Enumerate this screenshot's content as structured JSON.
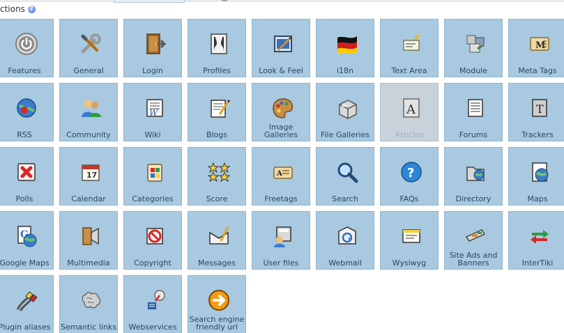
{
  "section": {
    "title": "ctions",
    "help_icon": "help-icon"
  },
  "tiles": [
    {
      "label": "Features",
      "icon": "power-icon"
    },
    {
      "label": "General",
      "icon": "wrench-screwdriver-icon"
    },
    {
      "label": "Login",
      "icon": "door-login-icon"
    },
    {
      "label": "Profiles",
      "icon": "profiles-icon"
    },
    {
      "label": "Look & Feel",
      "icon": "paint-window-icon"
    },
    {
      "label": "i18n",
      "icon": "flag-icon"
    },
    {
      "label": "Text Area",
      "icon": "text-area-icon"
    },
    {
      "label": "Module",
      "icon": "module-icon"
    },
    {
      "label": "Meta Tags",
      "icon": "meta-tags-icon"
    },
    {
      "label": "RSS",
      "icon": "rss-globe-icon"
    },
    {
      "label": "Community",
      "icon": "community-icon"
    },
    {
      "label": "Wiki",
      "icon": "wiki-icon"
    },
    {
      "label": "Blogs",
      "icon": "blogs-icon"
    },
    {
      "label": "Image Galleries",
      "icon": "palette-icon"
    },
    {
      "label": "File Galleries",
      "icon": "file-galleries-icon"
    },
    {
      "label": "Articles",
      "icon": "articles-icon",
      "disabled": true
    },
    {
      "label": "Forums",
      "icon": "forums-icon"
    },
    {
      "label": "Trackers",
      "icon": "trackers-icon"
    },
    {
      "label": "Polls",
      "icon": "polls-icon"
    },
    {
      "label": "Calendar",
      "icon": "calendar-icon"
    },
    {
      "label": "Categories",
      "icon": "categories-icon"
    },
    {
      "label": "Score",
      "icon": "score-stars-icon"
    },
    {
      "label": "Freetags",
      "icon": "freetags-icon"
    },
    {
      "label": "Search",
      "icon": "search-icon"
    },
    {
      "label": "FAQs",
      "icon": "faqs-icon"
    },
    {
      "label": "Directory",
      "icon": "directory-icon"
    },
    {
      "label": "Maps",
      "icon": "maps-icon"
    },
    {
      "label": "Google Maps",
      "icon": "google-maps-icon"
    },
    {
      "label": "Multimedia",
      "icon": "multimedia-icon"
    },
    {
      "label": "Copyright",
      "icon": "copyright-icon"
    },
    {
      "label": "Messages",
      "icon": "messages-icon"
    },
    {
      "label": "User files",
      "icon": "user-files-icon"
    },
    {
      "label": "Webmail",
      "icon": "webmail-icon"
    },
    {
      "label": "Wysiwyg",
      "icon": "wysiwyg-icon"
    },
    {
      "label": "Site Ads and Banners",
      "icon": "site-ads-icon"
    },
    {
      "label": "InterTiki",
      "icon": "intertiki-arrows-icon"
    },
    {
      "label": "Plugin aliases",
      "icon": "plugin-cables-icon"
    },
    {
      "label": "Semantic links",
      "icon": "brain-icon"
    },
    {
      "label": "Webservices",
      "icon": "webservices-icon"
    },
    {
      "label": "Search engine friendly url",
      "icon": "sefurl-icon"
    }
  ]
}
